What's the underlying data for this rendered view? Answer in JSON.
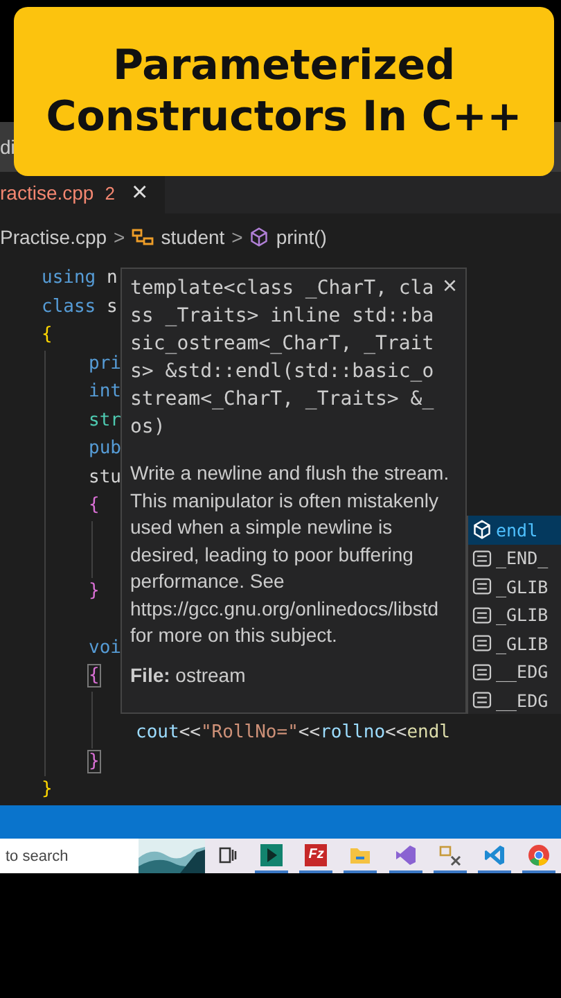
{
  "title_bar": {
    "fragment": "di"
  },
  "banner": {
    "lines": [
      "Parameterized",
      "Constructors In C++"
    ]
  },
  "tab": {
    "name": "ractise.cpp",
    "problems": "2",
    "close": "×",
    "selected": true
  },
  "breadcrumb": [
    {
      "kind": "file",
      "label": "Practise.cpp"
    },
    {
      "kind": "sep",
      "label": ">"
    },
    {
      "kind": "class",
      "label": "student"
    },
    {
      "kind": "sep",
      "label": ">"
    },
    {
      "kind": "method",
      "label": "print()"
    }
  ],
  "code": [
    {
      "kind": "code",
      "tokens": [
        {
          "kind": "keyword",
          "text": "using"
        },
        {
          "kind": "plain",
          "text": " n"
        }
      ]
    },
    {
      "kind": "code",
      "tokens": [
        {
          "kind": "keyword",
          "text": "class"
        },
        {
          "kind": "plain",
          "text": " s"
        }
      ]
    },
    {
      "kind": "code",
      "tokens": [
        {
          "kind": "brace1",
          "text": "{"
        }
      ]
    },
    {
      "kind": "block",
      "children": [
        {
          "kind": "code",
          "tokens": [
            {
              "kind": "keyword",
              "text": "pri"
            }
          ]
        },
        {
          "kind": "code",
          "tokens": [
            {
              "kind": "keyword",
              "text": "int"
            }
          ]
        },
        {
          "kind": "code",
          "tokens": [
            {
              "kind": "type",
              "text": "str"
            }
          ]
        },
        {
          "kind": "code",
          "tokens": [
            {
              "kind": "keyword",
              "text": "pub"
            }
          ]
        },
        {
          "kind": "code",
          "tokens": [
            {
              "kind": "plain",
              "text": "stu"
            }
          ]
        },
        {
          "kind": "code",
          "tokens": [
            {
              "kind": "brace2",
              "text": "{"
            }
          ]
        },
        {
          "kind": "block",
          "children": [
            {
              "kind": "blank"
            },
            {
              "kind": "blank"
            }
          ]
        },
        {
          "kind": "code",
          "tokens": [
            {
              "kind": "brace2",
              "text": "}"
            }
          ]
        },
        {
          "kind": "blank"
        },
        {
          "kind": "code",
          "tokens": [
            {
              "kind": "keyword",
              "text": "voi"
            }
          ]
        },
        {
          "kind": "code",
          "matched": true,
          "tokens": [
            {
              "kind": "brace2",
              "text": "{"
            }
          ]
        },
        {
          "kind": "block",
          "children": [
            {
              "kind": "blank"
            },
            {
              "kind": "code",
              "tokens": [
                {
                  "kind": "variable",
                  "text": "cout"
                },
                {
                  "kind": "plain",
                  "text": "<<"
                },
                {
                  "kind": "string",
                  "text": "\"RollNo=\""
                },
                {
                  "kind": "plain",
                  "text": "<<"
                },
                {
                  "kind": "variable",
                  "text": "rollno"
                },
                {
                  "kind": "plain",
                  "text": "<<"
                },
                {
                  "kind": "function",
                  "text": "endl"
                }
              ]
            }
          ]
        },
        {
          "kind": "code",
          "matched": true,
          "tokens": [
            {
              "kind": "brace2",
              "text": "}"
            }
          ]
        }
      ]
    },
    {
      "kind": "code",
      "tokens": [
        {
          "kind": "brace1",
          "text": "}"
        }
      ]
    }
  ],
  "hover": {
    "close": "×",
    "signature": "template<class _CharT, class _Traits> inline std::basic_ostream<_CharT, _Traits> &std::endl(std::basic_ostream<_CharT, _Traits> &_os)",
    "description": "Write a newline and flush the stream. This manipulator is often mistakenly used when a simple newline is desired, leading to poor buffering performance. See",
    "link": "https://gcc.gnu.org/onlinedocs/libstd",
    "description_end": "for more on this subject.",
    "file": "**File:** ostream"
  },
  "suggestions": [
    {
      "kind": "method",
      "label": "endl",
      "selected": true
    },
    {
      "kind": "macro",
      "label": "_END_",
      "selected": false
    },
    {
      "kind": "macro",
      "label": "_GLIB",
      "selected": false
    },
    {
      "kind": "macro",
      "label": "_GLIB",
      "selected": false
    },
    {
      "kind": "macro",
      "label": "_GLIB",
      "selected": false
    },
    {
      "kind": "macro",
      "label": "__EDG",
      "selected": false
    },
    {
      "kind": "macro",
      "label": "__EDG",
      "selected": false
    }
  ],
  "taskbar": {
    "search": "to search",
    "apps": [
      {
        "kind": "taskview",
        "running": false
      },
      {
        "kind": "play",
        "running": true
      },
      {
        "kind": "letters",
        "glyph": "Fz",
        "running": true
      },
      {
        "kind": "folder",
        "running": true
      },
      {
        "kind": "loop",
        "running": true
      },
      {
        "kind": "tool",
        "running": true
      },
      {
        "kind": "ribbon",
        "running": true
      },
      {
        "kind": "circle",
        "running": true
      }
    ]
  }
}
